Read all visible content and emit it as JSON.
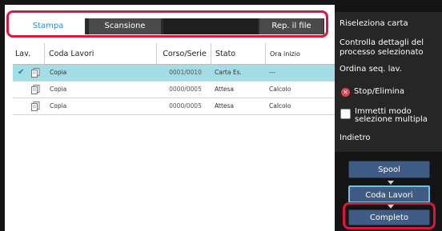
{
  "tabs": [
    {
      "label": "Stampa"
    },
    {
      "label": "Scansione"
    },
    {
      "label": ""
    },
    {
      "label": "Rep. il file"
    }
  ],
  "table": {
    "columns": [
      "Lav.",
      "Coda Lavori",
      "Corso/Serie",
      "Stato",
      "Ora inizio"
    ],
    "rows": [
      {
        "name": "Copia",
        "corso": "0001/0010",
        "stato": "Carta Es.",
        "ora": "---",
        "selected": true,
        "icon": "copy-doc-icon"
      },
      {
        "name": "Copia",
        "corso": "0000/0005",
        "stato": "Attesa",
        "ora": "Calcolo",
        "selected": false,
        "icon": "copy-doc-icon"
      },
      {
        "name": "Copia",
        "corso": "0000/0005",
        "stato": "Attesa",
        "ora": "Calcolo",
        "selected": false,
        "icon": "copy-doc-icon"
      }
    ]
  },
  "menu": {
    "riseleziona": "Riseleziona carta",
    "controlla": "Controlla dettagli del processo selezionato",
    "ordina": "Ordina seq. lav.",
    "stop": "Stop/Elimina",
    "immetti": "Immetti modo selezione multipla",
    "indietro": "Indietro"
  },
  "side_buttons": {
    "spool": "Spool",
    "coda": "Coda Lavori",
    "completo": "Completo"
  },
  "colors": {
    "highlight": "#e0143c",
    "selected_row": "#a3dde6",
    "button": "#3f5c85",
    "tab_active_text": "#2d8ccf"
  }
}
